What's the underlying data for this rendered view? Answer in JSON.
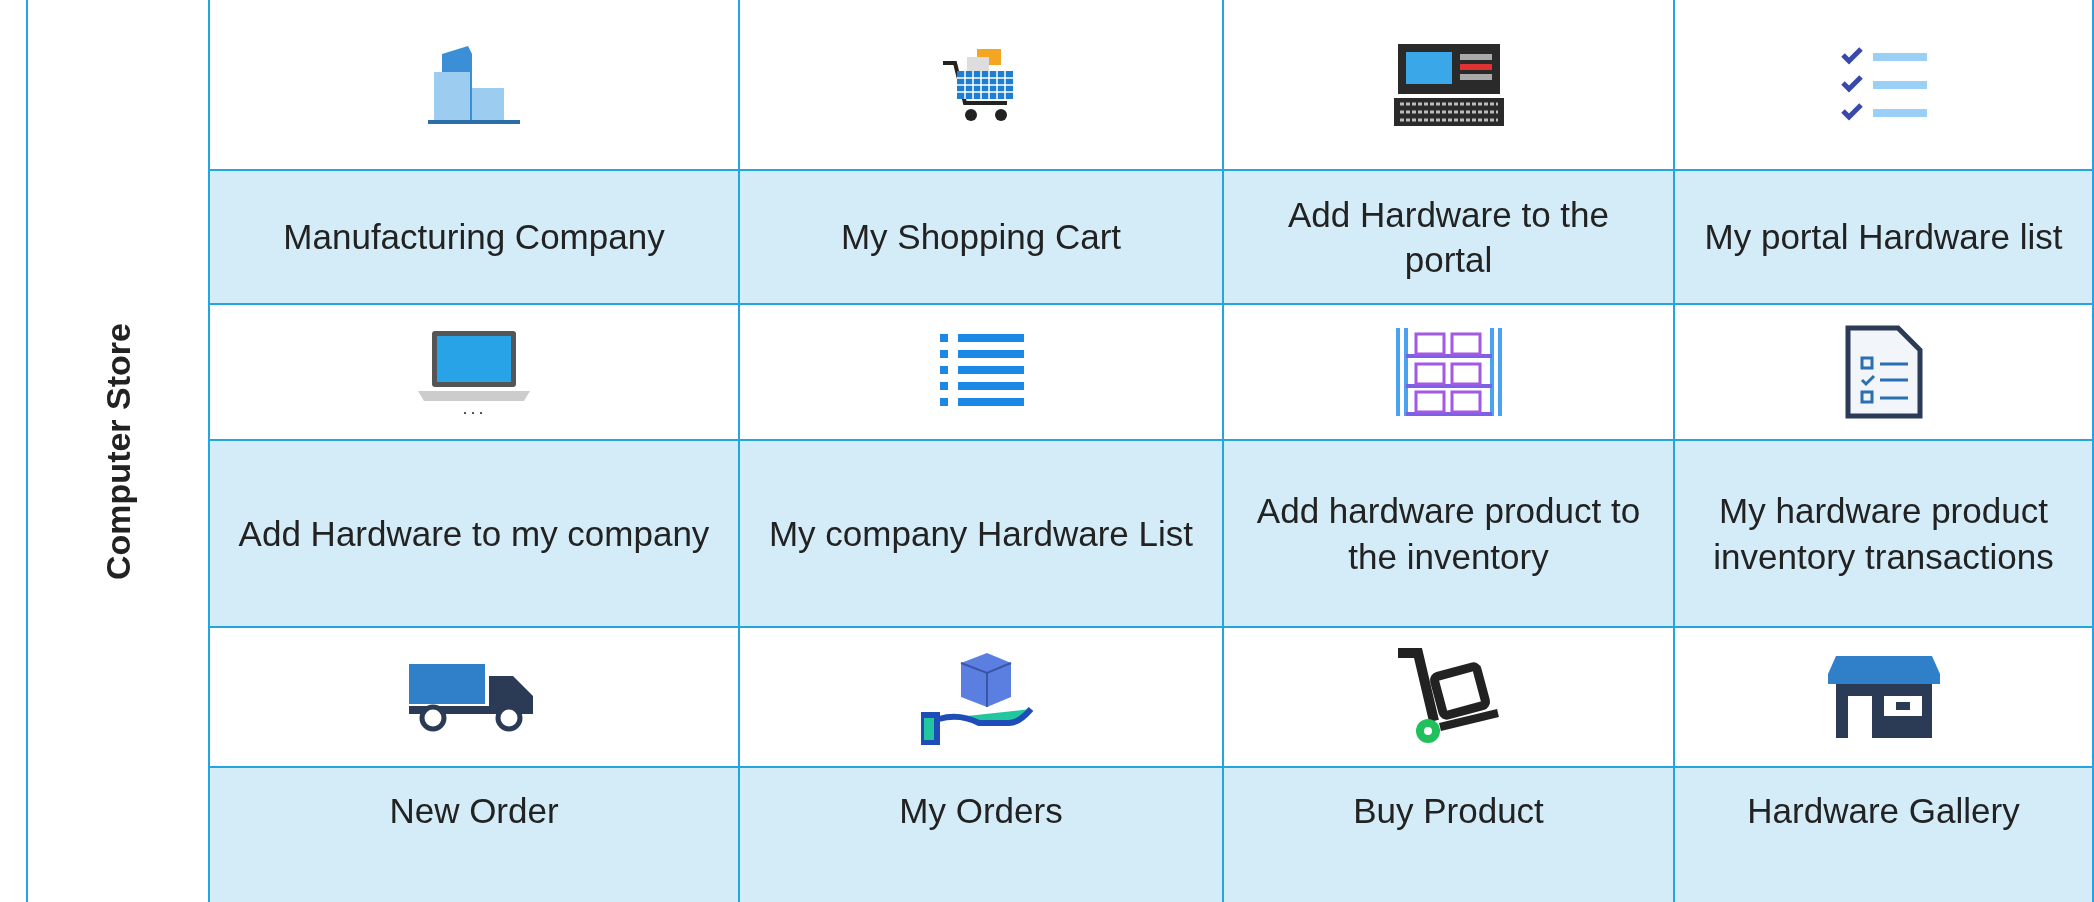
{
  "sidebar": {
    "title": "Computer Store"
  },
  "tiles": [
    {
      "label": "Manufacturing Company"
    },
    {
      "label": "My Shopping Cart"
    },
    {
      "label": "Add Hardware to the portal"
    },
    {
      "label": "My portal Hardware list"
    },
    {
      "label": "Add Hardware to my company"
    },
    {
      "label": "My company Hardware List"
    },
    {
      "label": "Add hardware product to the inventory"
    },
    {
      "label": "My hardware product inventory transactions"
    },
    {
      "label": "New Order"
    },
    {
      "label": "My Orders"
    },
    {
      "label": "Buy Product"
    },
    {
      "label": "Hardware Gallery"
    }
  ]
}
